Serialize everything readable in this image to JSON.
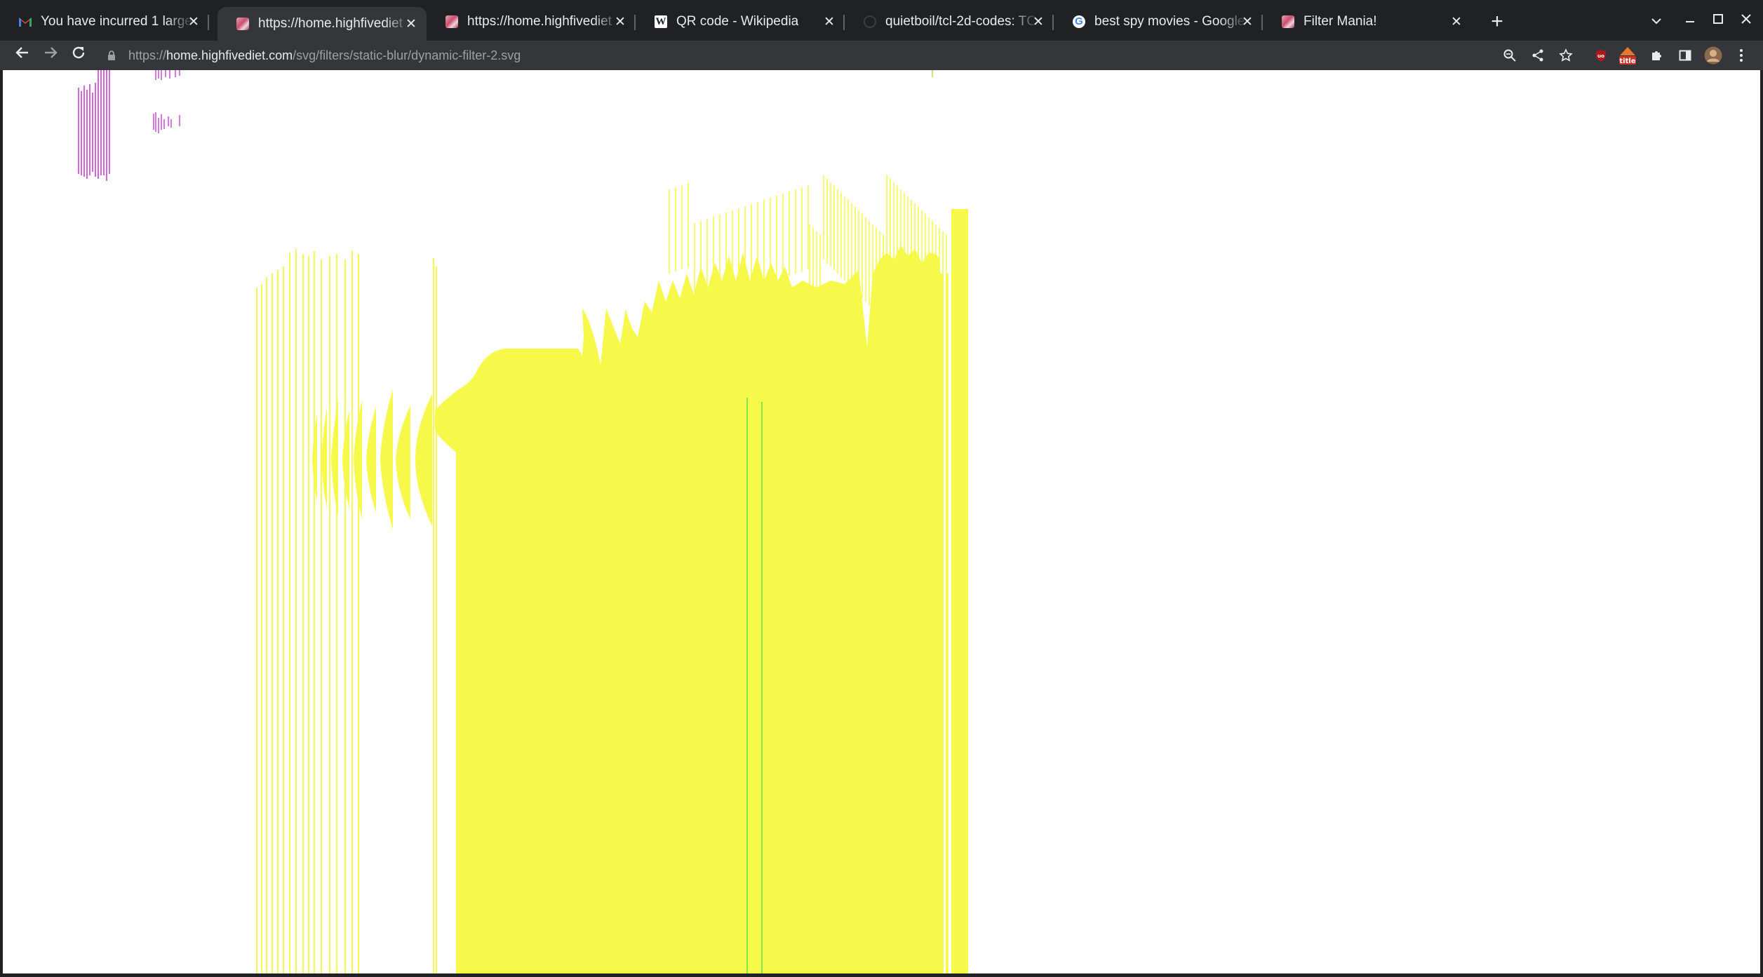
{
  "browser": {
    "tabs": [
      {
        "title": "You have incurred 1 large",
        "favicon": "gmail-icon",
        "active": false
      },
      {
        "title": "https://home.highfivediet",
        "favicon": "site-icon",
        "active": true
      },
      {
        "title": "https://home.highfivediet",
        "favicon": "site-icon",
        "active": false
      },
      {
        "title": "QR code - Wikipedia",
        "favicon": "wikipedia-icon",
        "active": false
      },
      {
        "title": "quietboil/tcl-2d-codes: TC",
        "favicon": "github-icon",
        "active": false
      },
      {
        "title": "best spy movies - Google",
        "favicon": "google-icon",
        "active": false
      },
      {
        "title": "Filter Mania!",
        "favicon": "site-icon",
        "active": false
      }
    ],
    "url": {
      "scheme": "https://",
      "host": "home.highfivediet.com",
      "path": "/svg/filters/static-blur/dynamic-filter-2.svg"
    },
    "extension_badge": "title"
  },
  "colors": {
    "chrome_dark": "#202124",
    "toolbar": "#35363a",
    "text": "#e8eaed",
    "blob_yellow": "#f7f94a",
    "accent_green": "#7ee84a",
    "accent_magenta": "#c63fd2"
  }
}
